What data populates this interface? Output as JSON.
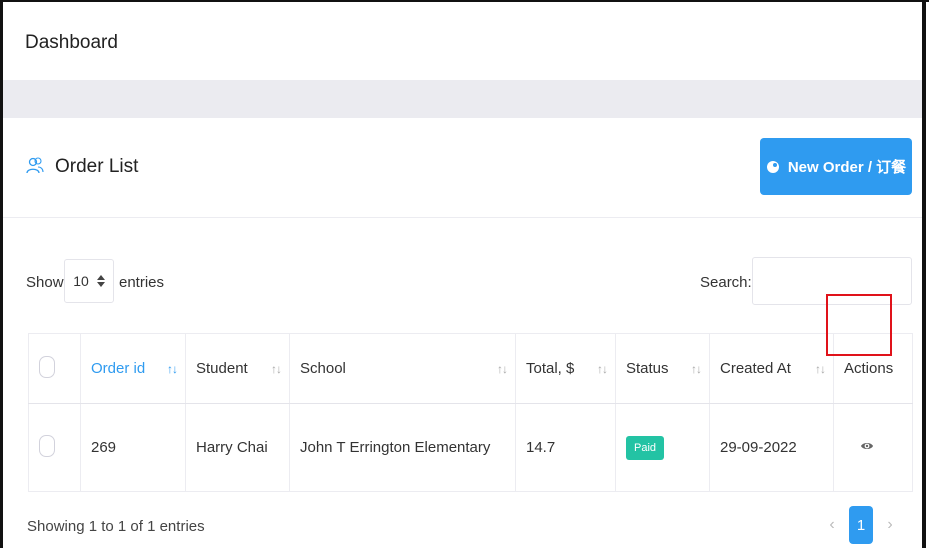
{
  "header": {
    "title": "Dashboard"
  },
  "card": {
    "title": "Order List",
    "title_icon": "users-icon",
    "new_order_label": "New Order / 订餐",
    "new_order_icon": "dot-circle-icon"
  },
  "length_control": {
    "show_label": "Show",
    "selected": "10",
    "entries_label": "entries"
  },
  "search": {
    "label": "Search:",
    "value": "",
    "placeholder": ""
  },
  "table": {
    "columns": [
      "Order id",
      "Student",
      "School",
      "Total, $",
      "Status",
      "Created At",
      "Actions"
    ],
    "rows": [
      {
        "order_id": "269",
        "student": "Harry Chai",
        "school": "John T Errington Elementary",
        "total": "14.7",
        "status": "Paid",
        "created_at": "29-09-2022",
        "action_icon": "eye-icon"
      }
    ]
  },
  "footer": {
    "info": "Showing 1 to 1 of 1 entries",
    "prev": "‹",
    "page": "1",
    "next": "›"
  },
  "colors": {
    "accent": "#2f9bf0",
    "status_paid": "#23c3a4",
    "highlight": "#e0121a",
    "band": "#ebebf0"
  }
}
